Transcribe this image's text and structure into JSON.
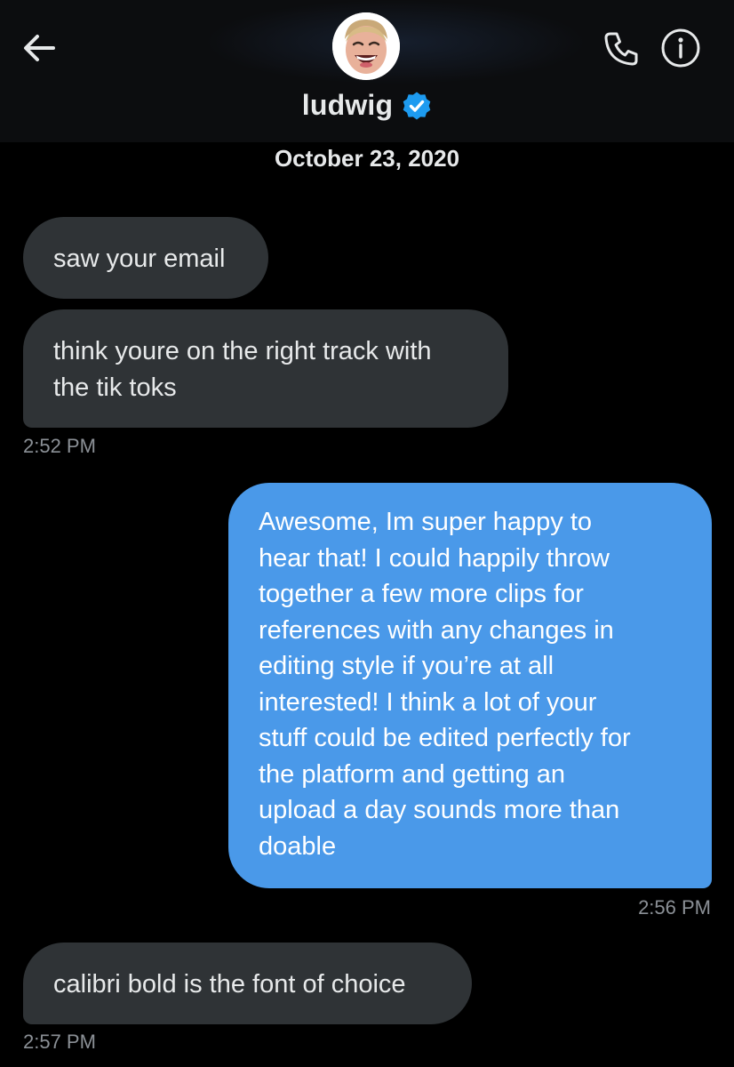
{
  "header": {
    "name": "ludwig",
    "back_icon": "arrow-left-icon",
    "verified_icon": "verified-badge-icon",
    "phone_icon": "phone-icon",
    "info_icon": "info-icon"
  },
  "conversation": {
    "date": "October 23, 2020",
    "messages": [
      {
        "direction": "incoming",
        "text": "saw your email"
      },
      {
        "direction": "incoming",
        "text": "think youre on the right track with\nthe tik toks",
        "time": "2:52 PM"
      },
      {
        "direction": "outgoing",
        "text": "Awesome, Im super happy to\nhear that! I could happily throw\ntogether a few more clips for\nreferences with any changes in\nediting style if you’re at all\ninterested! I think a lot of your\nstuff could be edited perfectly for\nthe platform and getting an\nupload a day sounds more than\ndoable",
        "time": "2:56 PM"
      },
      {
        "direction": "incoming",
        "text": "calibri bold is the font of choice",
        "time": "2:57 PM"
      }
    ]
  },
  "colors": {
    "background": "#000000",
    "incoming_bubble": "#2f3336",
    "outgoing_bubble": "#4a99e9",
    "verified_badge": "#1d9bf0",
    "timestamp": "#8b9096"
  }
}
